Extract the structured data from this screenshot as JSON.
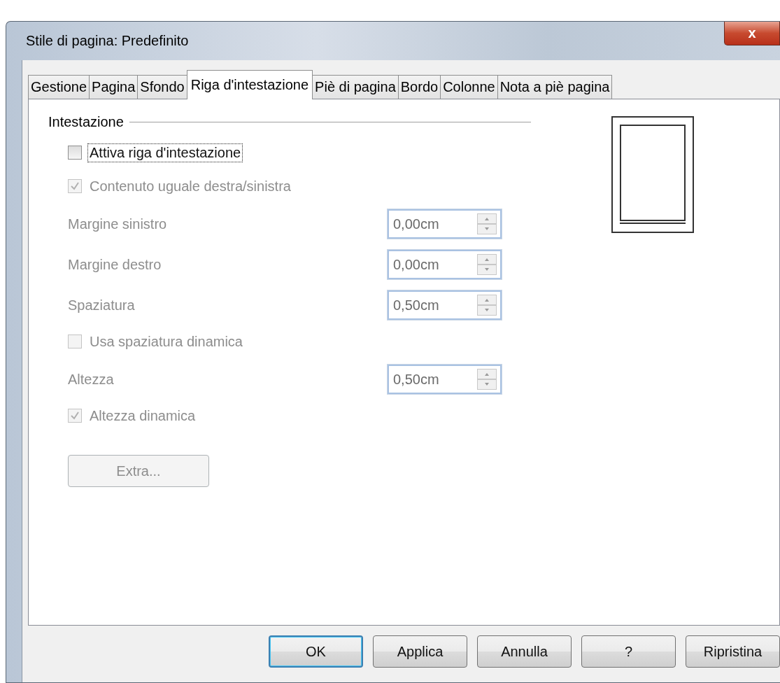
{
  "window": {
    "title": "Stile di pagina: Predefinito",
    "close": "x"
  },
  "tabs": [
    {
      "label": "Gestione",
      "selected": false
    },
    {
      "label": "Pagina",
      "selected": false
    },
    {
      "label": "Sfondo",
      "selected": false
    },
    {
      "label": "Riga d'intestazione",
      "selected": true
    },
    {
      "label": "Piè di pagina",
      "selected": false
    },
    {
      "label": "Bordo",
      "selected": false
    },
    {
      "label": "Colonne",
      "selected": false
    },
    {
      "label": "Nota a piè pagina",
      "selected": false
    }
  ],
  "section": {
    "title": "Intestazione"
  },
  "controls": [
    {
      "kind": "checkbox",
      "label": "Attiva riga d'intestazione",
      "checked": false,
      "disabled": false,
      "focused": true
    },
    {
      "kind": "checkbox",
      "label": "Contenuto uguale destra/sinistra",
      "checked": true,
      "disabled": true,
      "focused": false
    },
    {
      "kind": "spin",
      "label": "Margine sinistro",
      "value": "0,00cm",
      "disabled": true
    },
    {
      "kind": "spin",
      "label": "Margine destro",
      "value": "0,00cm",
      "disabled": true
    },
    {
      "kind": "spin",
      "label": "Spaziatura",
      "value": "0,50cm",
      "disabled": true
    },
    {
      "kind": "checkbox",
      "label": "Usa spaziatura dinamica",
      "checked": false,
      "disabled": true,
      "focused": false
    },
    {
      "kind": "spin",
      "label": "Altezza",
      "value": "0,50cm",
      "disabled": true
    },
    {
      "kind": "checkbox",
      "label": "Altezza dinamica",
      "checked": true,
      "disabled": true,
      "focused": false
    },
    {
      "kind": "button",
      "label": "Extra...",
      "disabled": true
    }
  ],
  "buttons": [
    {
      "label": "OK",
      "default": true
    },
    {
      "label": "Applica",
      "default": false
    },
    {
      "label": "Annulla",
      "default": false
    },
    {
      "label": "?",
      "default": false
    },
    {
      "label": "Ripristina",
      "default": false
    }
  ]
}
